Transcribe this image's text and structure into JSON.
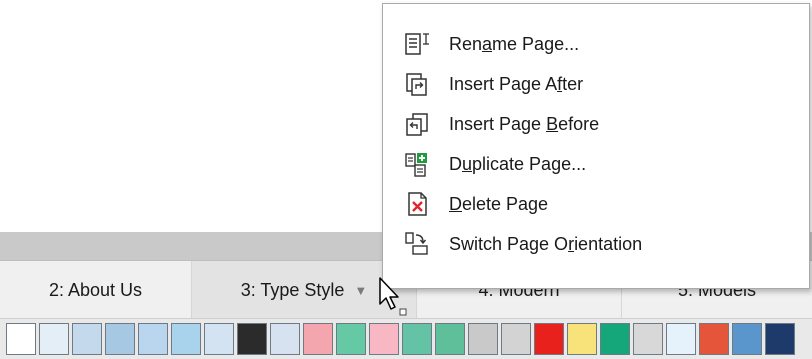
{
  "context_menu": {
    "items": [
      {
        "pre": "Ren",
        "key": "a",
        "post": "me Page...",
        "icon": "rename-page-icon"
      },
      {
        "pre": "Insert Page A",
        "key": "f",
        "post": "ter",
        "icon": "insert-page-after-icon"
      },
      {
        "pre": "Insert Page ",
        "key": "B",
        "post": "efore",
        "icon": "insert-page-before-icon"
      },
      {
        "pre": "D",
        "key": "u",
        "post": "plicate Page...",
        "icon": "duplicate-page-icon"
      },
      {
        "pre": "",
        "key": "D",
        "post": "elete Page",
        "icon": "delete-page-icon"
      },
      {
        "pre": "Switch Page O",
        "key": "r",
        "post": "ientation",
        "icon": "switch-orientation-icon"
      }
    ]
  },
  "page_tabs": [
    {
      "label": "2: About Us"
    },
    {
      "label": "3: Type Style",
      "active": true,
      "dropdown_icon": "dropdown-arrow-icon"
    },
    {
      "label": "4: Modern"
    },
    {
      "label": "5: Models"
    }
  ],
  "palette": {
    "colors": [
      "#ffffff",
      "#e4eef7",
      "#c5d9ec",
      "#a6c8e3",
      "#b9d6ee",
      "#a9d3ec",
      "#d4e3f1",
      "#2b2b2b",
      "#d6e2ef",
      "#f3a6ad",
      "#65c9a6",
      "#f7b8c4",
      "#63c3a4",
      "#5fbf9b",
      "#c9c9c9",
      "#d3d3d3",
      "#e8211c",
      "#f7e37a",
      "#15a77a",
      "#d8d8d8",
      "#e6f2fb",
      "#e5553a",
      "#5a96cb",
      "#1e3a6a"
    ]
  },
  "cursor": {
    "icon": "mouse-pointer-icon"
  }
}
